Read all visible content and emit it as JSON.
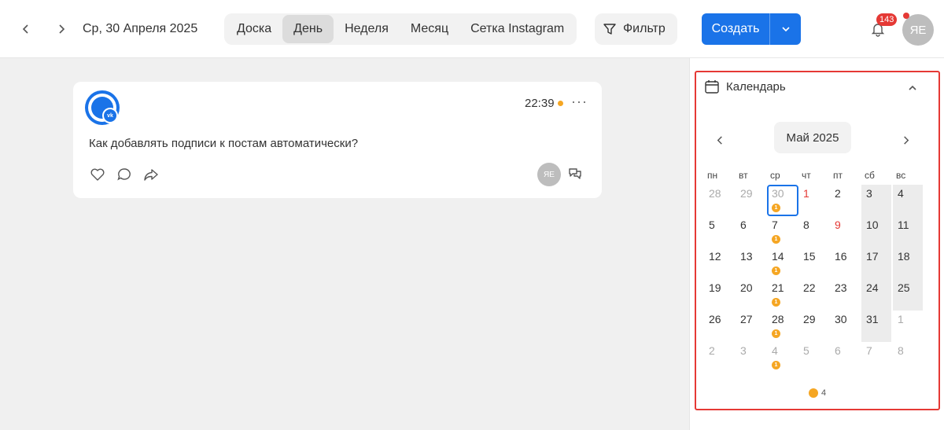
{
  "header": {
    "date": "Ср, 30 Апреля 2025",
    "tabs": [
      "Доска",
      "День",
      "Неделя",
      "Месяц",
      "Сетка Instagram"
    ],
    "active_tab": 1,
    "filter_label": "Фильтр",
    "create_label": "Создать",
    "notification_count": "143",
    "avatar_initials": "ЯЕ"
  },
  "post": {
    "time": "22:39",
    "text": "Как добавлять подписи к постам автоматически?",
    "author_initials": "ЯЕ",
    "network_badge": "vk"
  },
  "calendar": {
    "title": "Календарь",
    "month": "Май 2025",
    "weekdays": [
      "пн",
      "вт",
      "ср",
      "чт",
      "пт",
      "сб",
      "вс"
    ],
    "weeks": [
      [
        {
          "d": "28",
          "o": true
        },
        {
          "d": "29",
          "o": true
        },
        {
          "d": "30",
          "o": true,
          "today": true,
          "n": "1"
        },
        {
          "d": "1",
          "h": true
        },
        {
          "d": "2"
        },
        {
          "d": "3",
          "w": true
        },
        {
          "d": "4",
          "w": true
        }
      ],
      [
        {
          "d": "5"
        },
        {
          "d": "6"
        },
        {
          "d": "7",
          "n": "1"
        },
        {
          "d": "8"
        },
        {
          "d": "9",
          "h": true
        },
        {
          "d": "10",
          "w": true
        },
        {
          "d": "11",
          "w": true
        }
      ],
      [
        {
          "d": "12"
        },
        {
          "d": "13"
        },
        {
          "d": "14",
          "n": "1"
        },
        {
          "d": "15"
        },
        {
          "d": "16"
        },
        {
          "d": "17",
          "w": true
        },
        {
          "d": "18",
          "w": true
        }
      ],
      [
        {
          "d": "19"
        },
        {
          "d": "20"
        },
        {
          "d": "21",
          "n": "1"
        },
        {
          "d": "22"
        },
        {
          "d": "23"
        },
        {
          "d": "24",
          "w": true
        },
        {
          "d": "25",
          "w": true
        }
      ],
      [
        {
          "d": "26"
        },
        {
          "d": "27"
        },
        {
          "d": "28",
          "n": "1"
        },
        {
          "d": "29"
        },
        {
          "d": "30"
        },
        {
          "d": "31",
          "w": true
        },
        {
          "d": "1",
          "o": true
        }
      ],
      [
        {
          "d": "2",
          "o": true
        },
        {
          "d": "3",
          "o": true
        },
        {
          "d": "4",
          "o": true,
          "n": "1"
        },
        {
          "d": "5",
          "o": true
        },
        {
          "d": "6",
          "o": true
        },
        {
          "d": "7",
          "o": true
        },
        {
          "d": "8",
          "o": true
        }
      ]
    ],
    "legend_count": "4"
  },
  "colors": {
    "accent": "#1a73e8",
    "dot": "#f5a623",
    "highlight_border": "#e53935"
  }
}
